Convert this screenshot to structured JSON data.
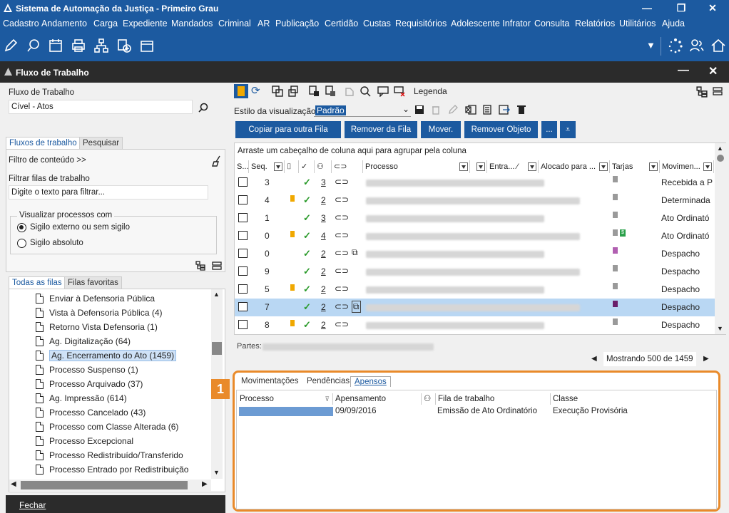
{
  "app": {
    "title": "Sistema de Automação da Justiça - Primeiro Grau"
  },
  "menu": [
    "Cadastro",
    "Andamento",
    "Carga",
    "Expediente",
    "Mandados",
    "Criminal",
    "AR",
    "Publicação",
    "Certidão",
    "Custas",
    "Requisitórios",
    "Adolescente Infrator",
    "Consulta",
    "Relatórios",
    "Utilitários",
    "Ajuda"
  ],
  "panel": {
    "title": "Fluxo de Trabalho"
  },
  "left": {
    "fluxo_label": "Fluxo de Trabalho",
    "fluxo_value": "Cível - Atos",
    "tabs": [
      "Fluxos de trabalho",
      "Pesquisar"
    ],
    "filtro_conteudo": "Filtro de conteúdo >>",
    "filtrar_label": "Filtrar filas de trabalho",
    "filtrar_placeholder": "Digite o texto para filtrar...",
    "visualizar_label": "Visualizar processos com",
    "radio1": "Sigilo externo ou sem sigilo",
    "radio2": "Sigilo absoluto",
    "queue_tabs": [
      "Todas as filas",
      "Filas favoritas"
    ],
    "queues": [
      "Enviar à Defensoria Pública",
      "Vista à Defensoria Pública (4)",
      "Retorno Vista Defensoria (1)",
      "Ag. Digitalização (64)",
      "Ag. Encerramento do Ato (1459)",
      "Processo Suspenso (1)",
      "Processo Arquivado (37)",
      "Ag. Impressão (614)",
      "Processo Cancelado (43)",
      "Processo com Classe Alterada (6)",
      "Processo Excepcional",
      "Processo Redistribuído/Transferido",
      "Processo Entrado por Redistribuição"
    ],
    "close_label": "Fechar"
  },
  "right": {
    "legend_label": "Legenda",
    "estilo_label": "Estilo da visualização",
    "estilo_value": "Padrão",
    "buttons": [
      "Copiar para outra Fila",
      "Remover da Fila",
      "Mover.",
      "Remover Objeto",
      "..."
    ],
    "group_hint": "Arraste um cabeçalho de coluna aqui para agrupar pela coluna",
    "columns": [
      "S...",
      "Seq.",
      "Processo",
      "Entra... ⁄",
      "Alocado para ...",
      "Tarjas",
      "Movimen..."
    ],
    "rows": [
      {
        "seq": "3",
        "flag": false,
        "num": "3",
        "tarja": "#9a9a9a",
        "mov": "Recebida a P"
      },
      {
        "seq": "4",
        "flag": true,
        "num": "2",
        "tarja": "#9a9a9a",
        "mov": "Determinada"
      },
      {
        "seq": "1",
        "flag": false,
        "num": "3",
        "tarja": "#9a9a9a",
        "mov": "Ato Ordinató"
      },
      {
        "seq": "0",
        "flag": true,
        "num": "4",
        "tarja": "#9a9a9a",
        "mov": "Ato Ordinató"
      },
      {
        "seq": "0",
        "flag": false,
        "num": "2",
        "tarja": "#b15fb1",
        "mov": "Despacho"
      },
      {
        "seq": "9",
        "flag": false,
        "num": "2",
        "tarja": "#9a9a9a",
        "mov": "Despacho"
      },
      {
        "seq": "5",
        "flag": true,
        "num": "2",
        "tarja": "#9a9a9a",
        "mov": "Despacho"
      },
      {
        "seq": "7",
        "flag": false,
        "num": "2",
        "tarja": "#6a1f6a",
        "mov": "Despacho"
      },
      {
        "seq": "8",
        "flag": true,
        "num": "2",
        "tarja": "#9a9a9a",
        "mov": "Despacho"
      }
    ],
    "partes_label": "Partes:",
    "mostrando": "Mostrando 500 de 1459"
  },
  "bottom": {
    "badge": "1",
    "tabs": [
      "Movimentações",
      "Pendências",
      "Apensos"
    ],
    "columns": [
      "Processo",
      "Apensamento",
      "Fila de trabalho",
      "Classe"
    ],
    "row": {
      "apensamento": "09/09/2016",
      "fila": "Emissão de Ato Ordinatório",
      "classe": "Execução Provisória"
    }
  }
}
